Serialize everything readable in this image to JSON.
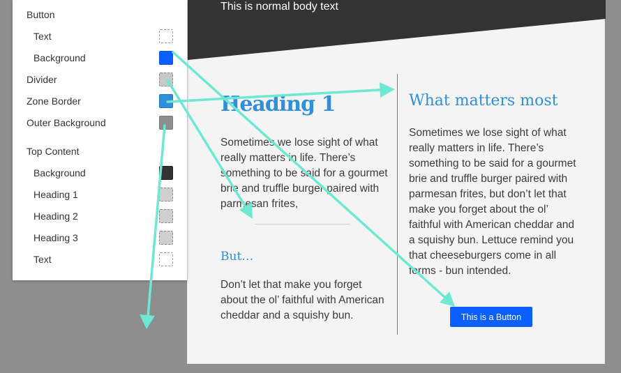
{
  "settings": {
    "button_group": "Button",
    "button_text": "Text",
    "button_background": "Background",
    "divider": "Divider",
    "zone_border": "Zone Border",
    "outer_background": "Outer Background",
    "top_content_group": "Top Content",
    "top_background": "Background",
    "heading_1": "Heading 1",
    "heading_2": "Heading 2",
    "heading_3": "Heading 3",
    "top_text": "Text"
  },
  "swatch_colors": {
    "button_background": "#0b5fff",
    "zone_border": "#2f8fd8",
    "outer_background": "#8e8e8e",
    "top_background": "#333333",
    "divider": "#c8c8c8"
  },
  "preview": {
    "body_text": "This is normal body text",
    "heading_1": "Heading 1",
    "left_para_1": "Sometimes we lose sight of what really matters in life. There’s something to be said for a gourmet brie and truffle burger paired with parmesan frites,",
    "heading_3": "But…",
    "left_para_2": "Don’t let that make you forget about the ol’ faithful with American cheddar and a squishy bun.",
    "heading_2": "What matters most",
    "right_para": "Sometimes we lose sight of what really matters in life. There’s something to be said for a gourmet brie and truffle burger paired with parmesan frites, but don’t let that make you forget about the ol’ faithful with American cheddar and a squishy bun. Lettuce remind you that cheeseburgers come in all forms - bun intended.",
    "button_label": "This is a Button"
  },
  "colors": {
    "accent": "#2f8fd8",
    "button": "#0b5fff",
    "top_band": "#333333",
    "canvas": "#f4f4f4",
    "outer": "#8e8e8e",
    "annotation_arrow": "#6ee8d3"
  }
}
